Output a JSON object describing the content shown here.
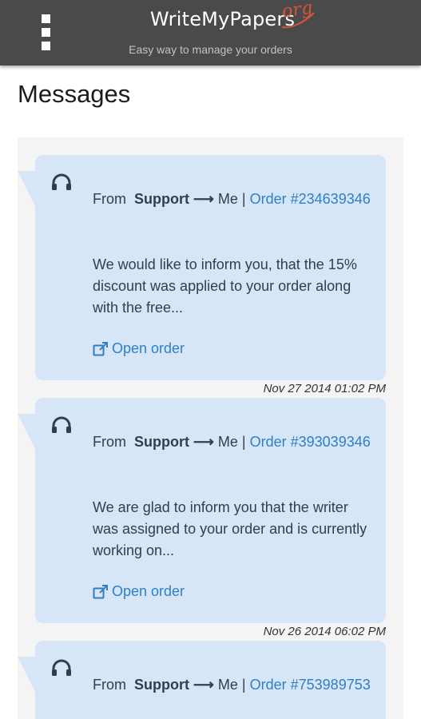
{
  "header": {
    "logo_text": "WriteMyPapers",
    "logo_suffix": "org",
    "tagline": "Easy way to manage your orders"
  },
  "page": {
    "title": "Messages"
  },
  "messages": [
    {
      "from_label": "From",
      "sender": "Support",
      "arrow": "⟶",
      "recipient": "Me",
      "separator": "|",
      "order_label": "Order",
      "order_number": "#234639346",
      "body": "We would like to inform you, that the 15% discount was applied to your order along with the free...",
      "open_label": "Open order",
      "date": "Nov 27 2014 01:02 PM"
    },
    {
      "from_label": "From",
      "sender": "Support",
      "arrow": "⟶",
      "recipient": "Me",
      "separator": "|",
      "order_label": "Order",
      "order_number": "#393039346",
      "body": "We are glad to inform you that the writer was assigned to your order and is currently working on...",
      "open_label": "Open order",
      "date": "Nov 26 2014 06:02 PM"
    },
    {
      "from_label": "From",
      "sender": "Support",
      "arrow": "⟶",
      "recipient": "Me",
      "separator": "|",
      "order_label": "Order",
      "order_number": "#753989753",
      "body": "",
      "open_label": "",
      "date": ""
    }
  ],
  "icons": {
    "menu": "menu-icon",
    "message": "headphones-icon",
    "open": "external-link-icon"
  },
  "colors": {
    "topbar": "#4a4a4a",
    "bubble": "#d6e6f7",
    "link": "#2f7fc4",
    "logo_accent": "#d9533a"
  }
}
